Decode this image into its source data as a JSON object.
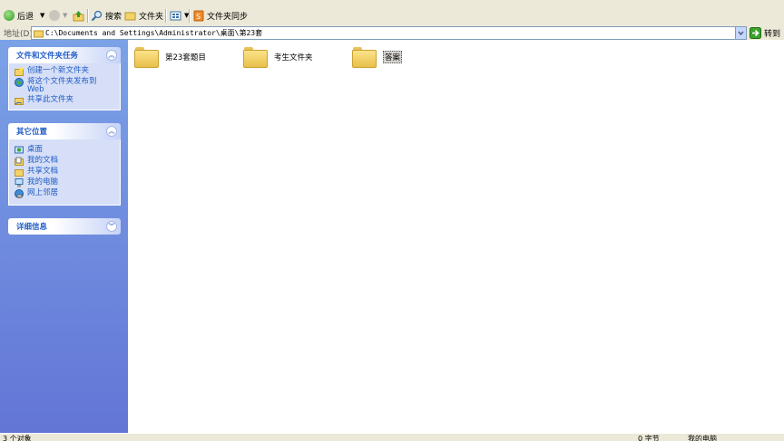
{
  "toolbar": {
    "back_label": "后退",
    "search_label": "搜索",
    "folders_label": "文件夹",
    "sync_label": "文件夹同步"
  },
  "address": {
    "label": "地址(D)",
    "path": "C:\\Documents and Settings\\Administrator\\桌面\\第23套",
    "go_label": "转到"
  },
  "tasks_panel": {
    "title": "文件和文件夹任务",
    "items": [
      {
        "label": "创建一个新文件夹",
        "icon": "new-folder-icon"
      },
      {
        "label": "将这个文件夹发布到 Web",
        "icon": "publish-web-icon"
      },
      {
        "label": "共享此文件夹",
        "icon": "share-folder-icon"
      }
    ]
  },
  "places_panel": {
    "title": "其它位置",
    "items": [
      {
        "label": "桌面",
        "icon": "desktop-icon"
      },
      {
        "label": "我的文档",
        "icon": "my-documents-icon"
      },
      {
        "label": "共享文档",
        "icon": "shared-documents-icon"
      },
      {
        "label": "我的电脑",
        "icon": "my-computer-icon"
      },
      {
        "label": "网上邻居",
        "icon": "network-icon"
      }
    ]
  },
  "details_panel": {
    "title": "详细信息"
  },
  "files": [
    {
      "name": "第23套题目",
      "icon": "folder-icon",
      "selected": false
    },
    {
      "name": "考生文件夹",
      "icon": "folder-icon",
      "selected": false
    },
    {
      "name": "答案",
      "icon": "folder-icon",
      "selected": true
    }
  ],
  "status": {
    "count": "3 个对象",
    "size": "0 字节",
    "location": "我的电脑"
  }
}
